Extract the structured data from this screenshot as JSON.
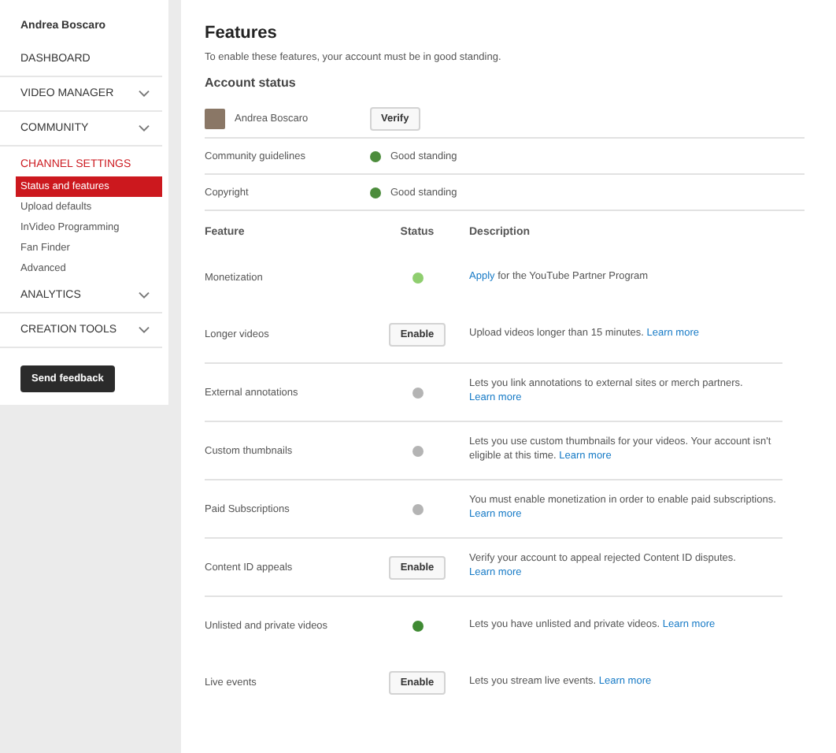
{
  "sidebar": {
    "user_name": "Andrea Boscaro",
    "items": [
      {
        "label": "DASHBOARD",
        "kind": "section",
        "expandable": false,
        "selected": false
      },
      {
        "label": "VIDEO MANAGER",
        "kind": "section",
        "expandable": true,
        "selected": false
      },
      {
        "label": "COMMUNITY",
        "kind": "section",
        "expandable": true,
        "selected": false
      },
      {
        "label": "CHANNEL SETTINGS",
        "kind": "header",
        "selected": true
      },
      {
        "label": "Status and features",
        "kind": "sub",
        "selected": true
      },
      {
        "label": "Upload defaults",
        "kind": "sub",
        "selected": false
      },
      {
        "label": "InVideo Programming",
        "kind": "sub",
        "selected": false
      },
      {
        "label": "Fan Finder",
        "kind": "sub",
        "selected": false
      },
      {
        "label": "Advanced",
        "kind": "sub",
        "selected": false
      },
      {
        "label": "ANALYTICS",
        "kind": "section",
        "expandable": true,
        "selected": false
      },
      {
        "label": "CREATION TOOLS",
        "kind": "section",
        "expandable": true,
        "selected": false
      }
    ],
    "feedback_button": "Send feedback"
  },
  "title": "Features",
  "intro": "To enable these features, your account must be in good standing.",
  "account_status": {
    "heading": "Account status",
    "name": "Andrea Boscaro",
    "verify_button": "Verify",
    "rows": [
      {
        "label": "Community guidelines",
        "status": "Good standing",
        "color": "#4c8c3c"
      },
      {
        "label": "Copyright",
        "status": "Good standing",
        "color": "#4c8c3c"
      }
    ]
  },
  "columns": [
    "Feature",
    "Status",
    "Description"
  ],
  "features": [
    {
      "name": "Monetization",
      "kind": "dot",
      "color": "#8fce6f",
      "description": [
        {
          "text": "Apply",
          "link": true
        },
        {
          "text": " for the YouTube Partner Program",
          "link": false
        }
      ]
    },
    {
      "name": "Longer videos",
      "kind": "button",
      "button": "Enable",
      "description": [
        {
          "text": "Upload videos longer than 15 minutes. ",
          "link": false
        },
        {
          "text": "Learn more",
          "link": true
        }
      ]
    },
    {
      "name": "External annotations",
      "kind": "dot",
      "color": "#b4b4b4",
      "description": [
        {
          "text": "Lets you link annotations to external sites or merch partners. ",
          "link": false
        },
        {
          "text": "Learn more",
          "link": true
        }
      ]
    },
    {
      "name": "Custom thumbnails",
      "kind": "dot",
      "color": "#b4b4b4",
      "description": [
        {
          "text": "Lets you use custom thumbnails for your videos. Your account isn't eligible at this time. ",
          "link": false
        },
        {
          "text": "Learn more",
          "link": true
        }
      ]
    },
    {
      "name": "Paid Subscriptions",
      "kind": "dot",
      "color": "#b4b4b4",
      "description": [
        {
          "text": "You must enable monetization in order to enable paid subscriptions. ",
          "link": false
        },
        {
          "text": "Learn more",
          "link": true
        }
      ]
    },
    {
      "name": "Content ID appeals",
      "kind": "button",
      "button": "Enable",
      "description": [
        {
          "text": "Verify your account to appeal rejected Content ID disputes. ",
          "link": false
        },
        {
          "text": "Learn more",
          "link": true
        }
      ]
    },
    {
      "name": "Unlisted and private videos",
      "kind": "dot",
      "color": "#3f8a33",
      "description": [
        {
          "text": "Lets you have unlisted and private videos. ",
          "link": false
        },
        {
          "text": "Learn more",
          "link": true
        }
      ]
    },
    {
      "name": "Live events",
      "kind": "button",
      "button": "Enable",
      "description": [
        {
          "text": "Lets you stream live events. ",
          "link": false
        },
        {
          "text": "Learn more",
          "link": true
        }
      ]
    }
  ]
}
